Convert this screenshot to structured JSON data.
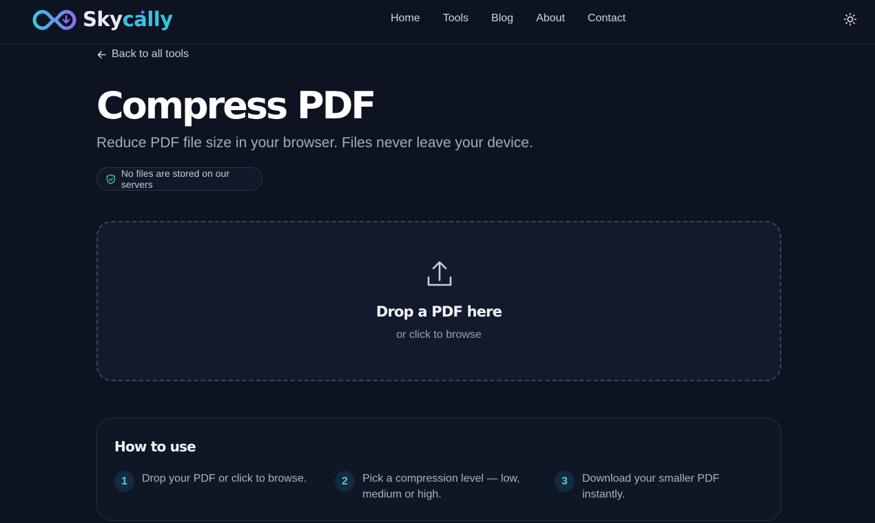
{
  "brand": {
    "name_part1": "Sky",
    "name_part2": "cally",
    "colors": {
      "primary": "#37c3e0",
      "accent": "#8b6ff2"
    }
  },
  "nav": {
    "items": [
      {
        "label": "Home"
      },
      {
        "label": "Tools"
      },
      {
        "label": "Blog"
      },
      {
        "label": "About"
      },
      {
        "label": "Contact"
      }
    ],
    "theme_toggle_icon": "sun-icon"
  },
  "back_link": {
    "label": "Back to all tools",
    "icon": "arrow-left-icon"
  },
  "page": {
    "title": "Compress PDF",
    "subtitle": "Reduce PDF file size in your browser. Files never leave your device.",
    "badge": {
      "label": "No files are stored on our servers",
      "icon": "shield-check-icon"
    }
  },
  "dropzone": {
    "icon": "upload-icon",
    "title": "Drop a PDF here",
    "subtitle": "or click to browse"
  },
  "how_to": {
    "title": "How to use",
    "steps": [
      {
        "number": "1",
        "text": "Drop your PDF or click to browse."
      },
      {
        "number": "2",
        "text": "Pick a compression level — low, medium or high."
      },
      {
        "number": "3",
        "text": "Download your smaller PDF instantly."
      }
    ]
  }
}
